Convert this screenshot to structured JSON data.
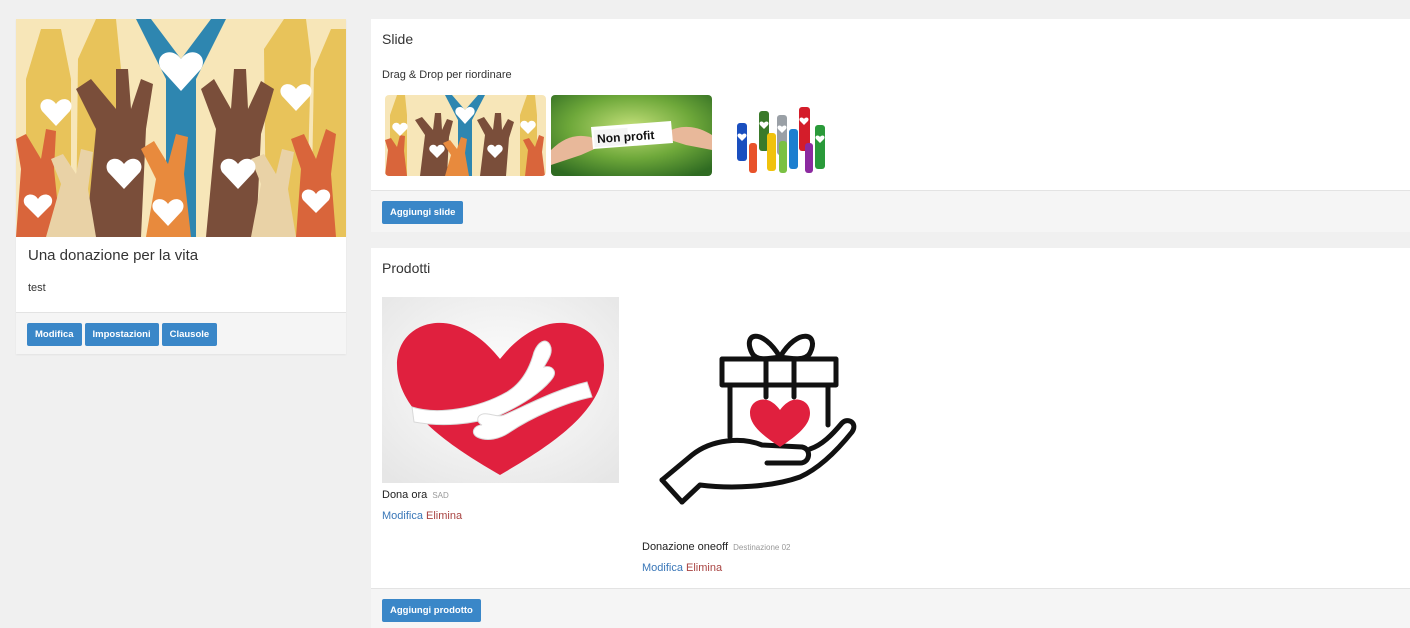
{
  "campaign": {
    "title": "Una donazione per la vita",
    "description": "test",
    "buttons": {
      "edit": "Modifica",
      "settings": "Impostazioni",
      "clauses": "Clausole"
    }
  },
  "slide_panel": {
    "title": "Slide",
    "hint": "Drag & Drop per riordinare",
    "slide2_text": "Non profit",
    "add_button": "Aggiungi slide"
  },
  "products_panel": {
    "title": "Prodotti",
    "items": [
      {
        "name": "Dona ora",
        "tag": "SAD",
        "edit": "Modifica",
        "delete": "Elimina"
      },
      {
        "name": "Donazione oneoff",
        "tag": "Destinazione 02",
        "edit": "Modifica",
        "delete": "Elimina"
      }
    ],
    "add_button": "Aggiungi prodotto"
  },
  "colors": {
    "primary_button": "#3a87c8",
    "edit_link": "#3a77b8",
    "delete_link": "#a94442",
    "heart_red": "#e0203e"
  }
}
